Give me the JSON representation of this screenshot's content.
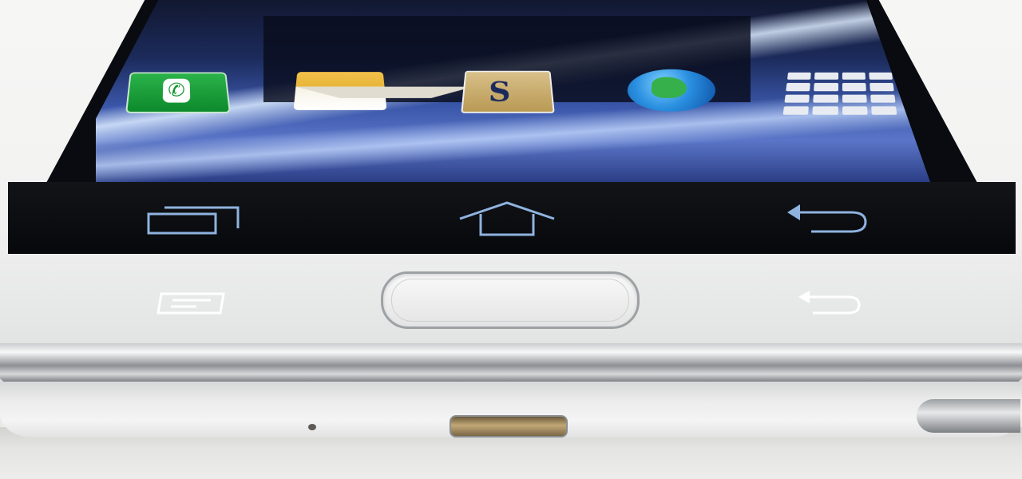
{
  "scene": {
    "description_icons": [
      "phone-icon",
      "messaging-icon",
      "s-note-icon",
      "internet-globe-icon",
      "apps-grid-icon",
      "recent-apps-icon",
      "home-icon",
      "back-icon",
      "menu-key-icon",
      "back-key-icon"
    ]
  },
  "dock": {
    "phone": {
      "icon": "phone-icon",
      "color": "#1fa33e"
    },
    "messaging": {
      "icon": "messaging-icon",
      "color": "#f3c14a"
    },
    "s_note": {
      "icon": "s-note-icon",
      "label": "S"
    },
    "internet": {
      "icon": "internet-globe-icon",
      "color": "#2a8fe0"
    },
    "apps": {
      "icon": "apps-grid-icon"
    }
  },
  "navbar": {
    "recent_apps": {
      "icon": "recent-apps-icon"
    },
    "home": {
      "icon": "home-icon"
    },
    "back": {
      "icon": "back-icon"
    },
    "color": "#8fb3df"
  },
  "hardware": {
    "menu_key": {
      "icon": "menu-key-icon"
    },
    "home_key": {
      "icon": "home-button"
    },
    "back_key": {
      "icon": "back-key-icon"
    }
  },
  "colors": {
    "body": "#f2f2f1",
    "screen": "#0a0b10",
    "wallpaper_blue": "#3a56a8"
  }
}
